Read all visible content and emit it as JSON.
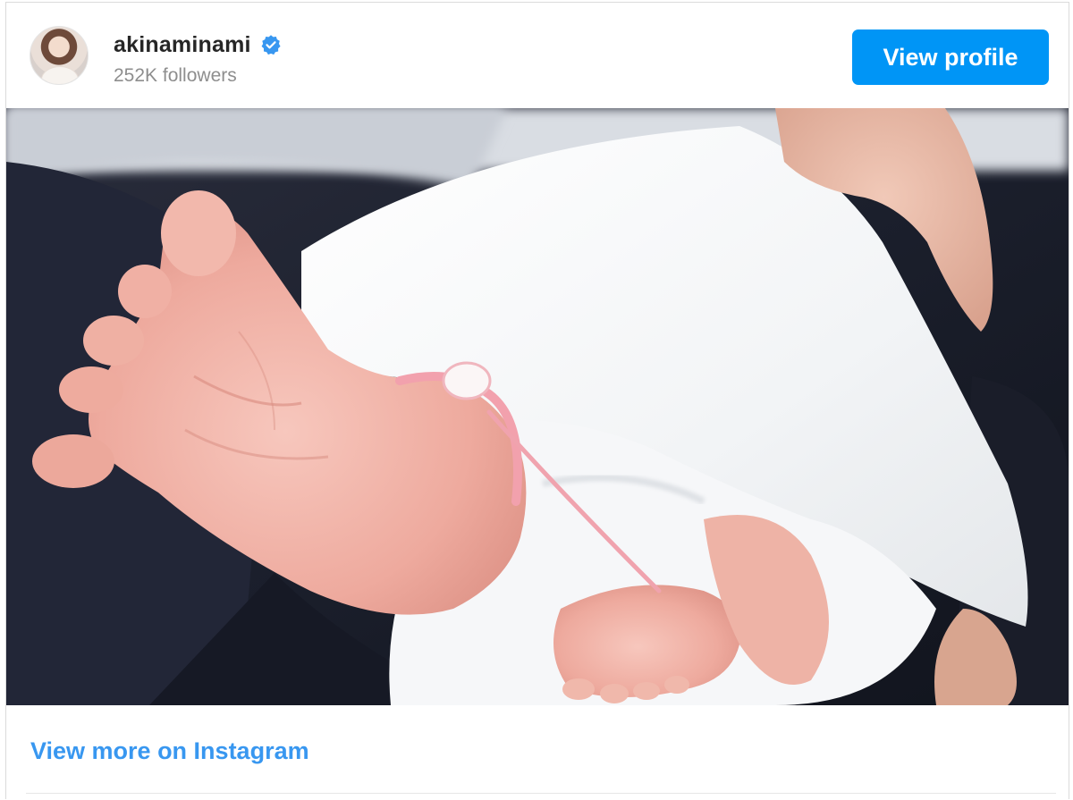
{
  "header": {
    "username": "akinaminami",
    "verified": true,
    "followers": "252K followers",
    "view_profile_label": "View profile"
  },
  "post": {
    "image_alt": "akinaminami Instagram post photo"
  },
  "footer": {
    "view_more_label": "View more on Instagram"
  },
  "colors": {
    "primary_button": "#0095f6",
    "link": "#3897f0",
    "verified_badge": "#3897f0",
    "secondary_text": "#8e8e8e"
  },
  "icons": {
    "verified": "verified-badge-icon"
  }
}
